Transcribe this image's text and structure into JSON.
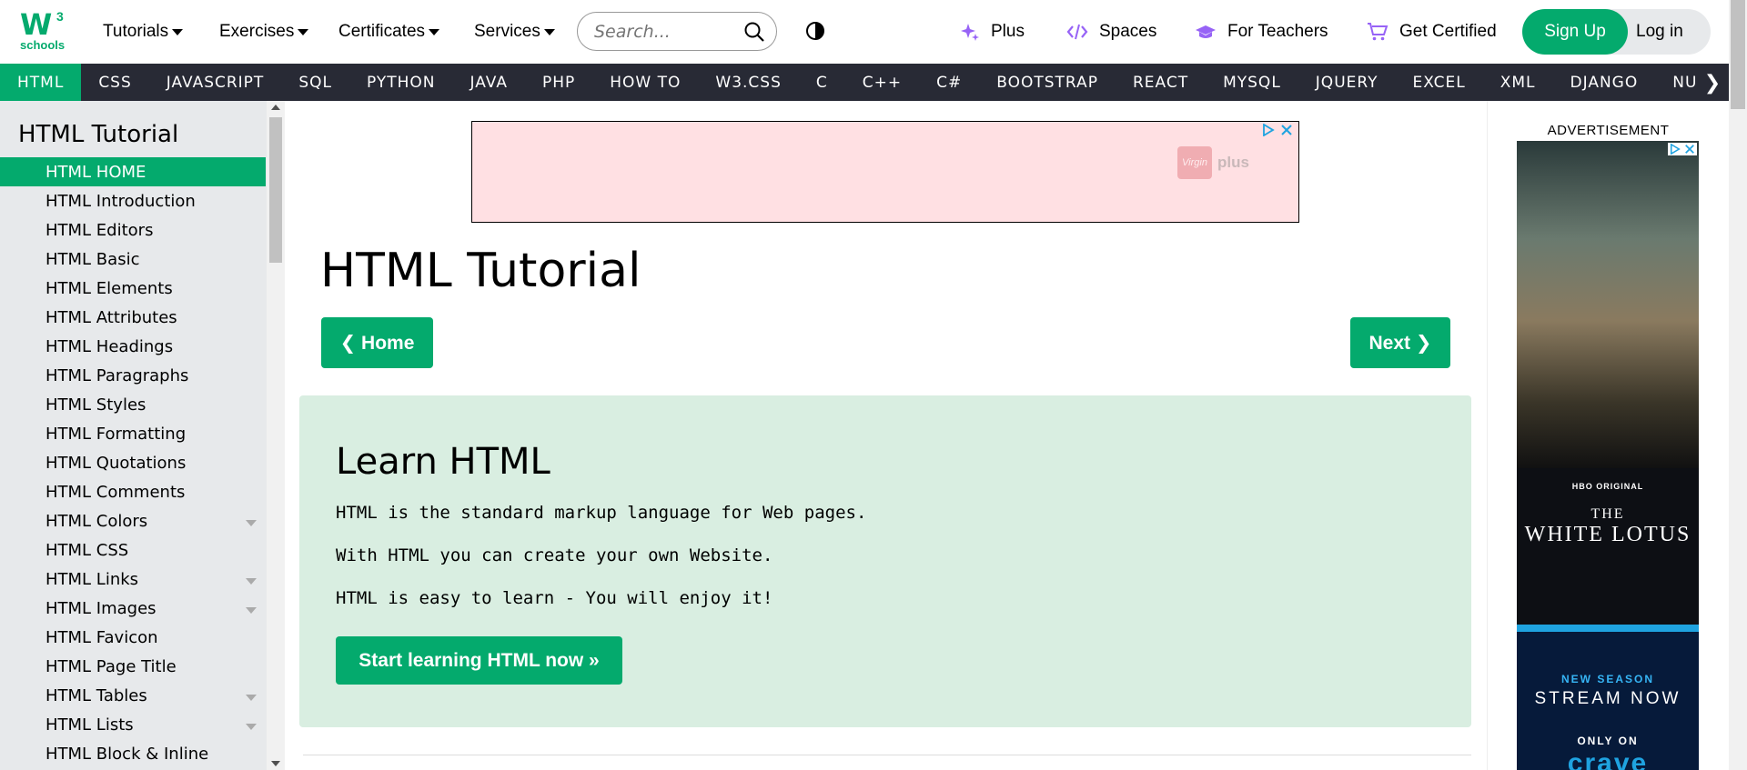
{
  "brand": {
    "logo_main": "W3",
    "logo_sup": "3",
    "logo_text": "schools",
    "accent": "#04AA6D",
    "nav_bg": "#282A35"
  },
  "header": {
    "menus": [
      {
        "label": "Tutorials"
      },
      {
        "label": "Exercises"
      },
      {
        "label": "Certificates"
      },
      {
        "label": "Services"
      }
    ],
    "search": {
      "placeholder": "Search..."
    },
    "links": [
      {
        "label": "Plus",
        "icon": "sparkle-icon"
      },
      {
        "label": "Spaces",
        "icon": "code-icon"
      },
      {
        "label": "For Teachers",
        "icon": "graduation-cap-icon"
      },
      {
        "label": "Get Certified",
        "icon": "cart-icon"
      }
    ],
    "signup": "Sign Up",
    "login": "Log in"
  },
  "navbar": {
    "items": [
      "HTML",
      "CSS",
      "JAVASCRIPT",
      "SQL",
      "PYTHON",
      "JAVA",
      "PHP",
      "HOW TO",
      "W3.CSS",
      "C",
      "C++",
      "C#",
      "BOOTSTRAP",
      "REACT",
      "MYSQL",
      "JQUERY",
      "EXCEL",
      "XML",
      "DJANGO",
      "NUMPY"
    ],
    "active": "HTML",
    "next_glyph": "❯"
  },
  "sidebar": {
    "title": "HTML Tutorial",
    "items": [
      {
        "label": "HTML HOME",
        "active": true
      },
      {
        "label": "HTML Introduction"
      },
      {
        "label": "HTML Editors"
      },
      {
        "label": "HTML Basic"
      },
      {
        "label": "HTML Elements"
      },
      {
        "label": "HTML Attributes"
      },
      {
        "label": "HTML Headings"
      },
      {
        "label": "HTML Paragraphs"
      },
      {
        "label": "HTML Styles"
      },
      {
        "label": "HTML Formatting"
      },
      {
        "label": "HTML Quotations"
      },
      {
        "label": "HTML Comments"
      },
      {
        "label": "HTML Colors",
        "expandable": true
      },
      {
        "label": "HTML CSS"
      },
      {
        "label": "HTML Links",
        "expandable": true
      },
      {
        "label": "HTML Images",
        "expandable": true
      },
      {
        "label": "HTML Favicon"
      },
      {
        "label": "HTML Page Title"
      },
      {
        "label": "HTML Tables",
        "expandable": true
      },
      {
        "label": "HTML Lists",
        "expandable": true
      },
      {
        "label": "HTML Block & Inline"
      }
    ]
  },
  "main": {
    "ad_brand": "Virgin",
    "ad_plus": "plus",
    "title": "HTML Tutorial",
    "home_btn": "❮ Home",
    "next_btn": "Next ❯",
    "learn": {
      "heading": "Learn HTML",
      "lines": [
        "HTML is the standard markup language for Web pages.",
        "With HTML you can create your own Website.",
        "HTML is easy to learn - You will enjoy it!"
      ],
      "button": "Start learning HTML now »"
    }
  },
  "right_ad": {
    "label": "ADVERTISEMENT",
    "network": "HBO ORIGINAL",
    "show_the": "THE",
    "show_name": "WHITE LOTUS",
    "new_season": "NEW SEASON",
    "stream_now": "STREAM NOW",
    "only_on": "ONLY ON",
    "platform": "crave"
  }
}
